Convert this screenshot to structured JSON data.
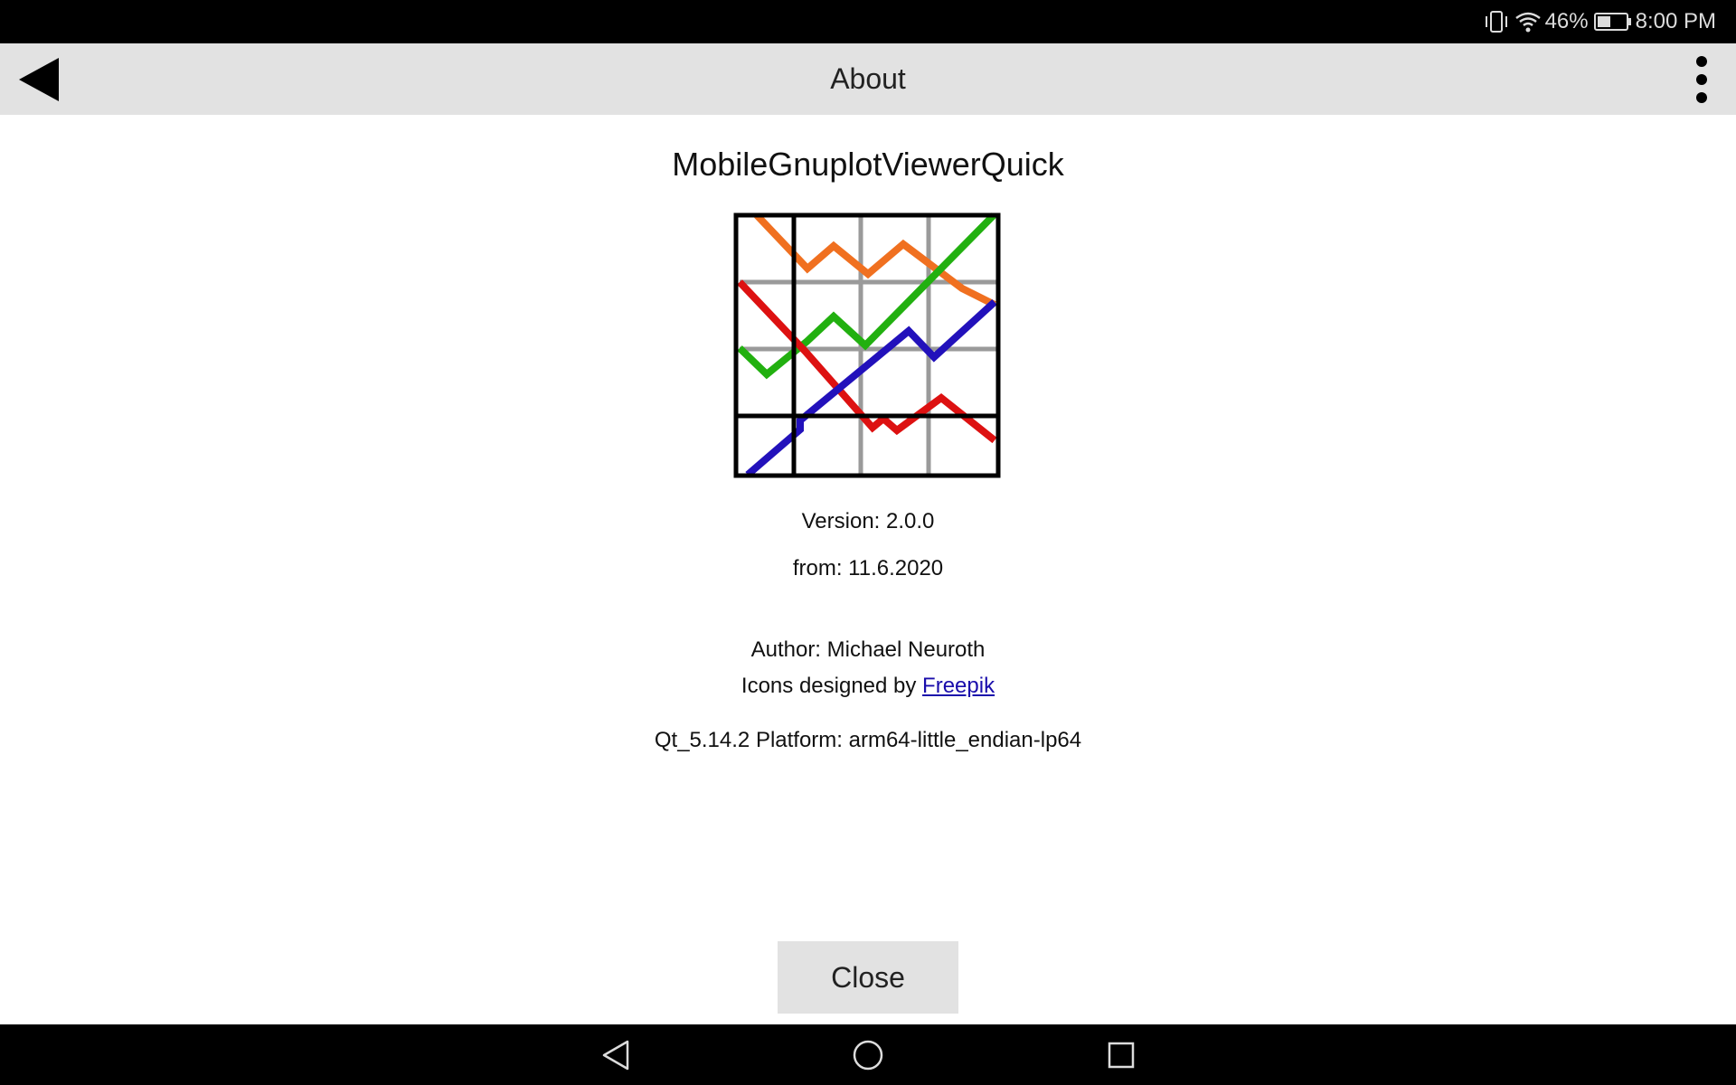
{
  "status_bar": {
    "battery_percent": "46%",
    "time": "8:00 PM",
    "icons": [
      "vibrate-icon",
      "wifi-icon",
      "battery-icon"
    ]
  },
  "app_bar": {
    "title": "About",
    "back_icon": "back-arrow-icon",
    "menu_icon": "overflow-menu-icon"
  },
  "about": {
    "app_name": "MobileGnuplotViewerQuick",
    "logo_icon": "chart-logo-icon",
    "version": "Version: 2.0.0",
    "date": "from: 11.6.2020",
    "author": "Author: Michael Neuroth",
    "icons_credit_prefix": "Icons designed by ",
    "icons_credit_link": "Freepik",
    "platform": "Qt_5.14.2 Platform: arm64-little_endian-lp64"
  },
  "close_button": {
    "label": "Close"
  },
  "nav_bar": {
    "icons": [
      "nav-back-icon",
      "nav-home-icon",
      "nav-recents-icon"
    ]
  },
  "colors": {
    "status_bar_bg": "#000000",
    "app_bar_bg": "#e2e2e2",
    "button_bg": "#e2e2e2",
    "link": "#1a0dab",
    "logo_orange": "#f07020",
    "logo_green": "#22b010",
    "logo_red": "#dd1111",
    "logo_blue": "#2211bb"
  }
}
